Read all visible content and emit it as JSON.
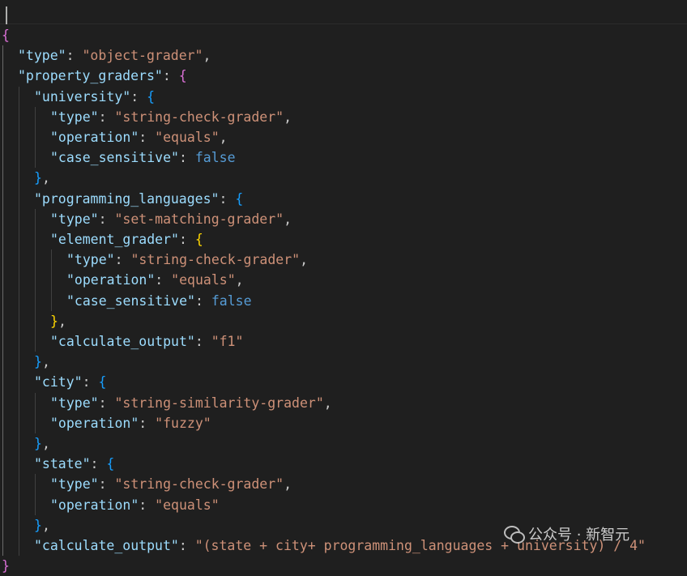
{
  "editor": {
    "language": "json",
    "colors": {
      "background": "#1f1f1f",
      "key": "#9cdcfe",
      "string": "#ce9178",
      "keyword": "#569cd6",
      "bracket_level1": "#da70d6",
      "bracket_level2": "#179fff",
      "bracket_level3": "#ffd700"
    },
    "lines": [
      {
        "indent": 0,
        "tokens": [
          {
            "t": "{",
            "c": "b1"
          }
        ]
      },
      {
        "indent": 1,
        "tokens": [
          {
            "t": "\"type\"",
            "c": "key"
          },
          {
            "t": ": ",
            "c": "punc"
          },
          {
            "t": "\"object-grader\"",
            "c": "str"
          },
          {
            "t": ",",
            "c": "punc"
          }
        ]
      },
      {
        "indent": 1,
        "tokens": [
          {
            "t": "\"property_graders\"",
            "c": "key"
          },
          {
            "t": ": ",
            "c": "punc"
          },
          {
            "t": "{",
            "c": "b1"
          }
        ]
      },
      {
        "indent": 2,
        "tokens": [
          {
            "t": "\"university\"",
            "c": "key"
          },
          {
            "t": ": ",
            "c": "punc"
          },
          {
            "t": "{",
            "c": "b2"
          }
        ]
      },
      {
        "indent": 3,
        "tokens": [
          {
            "t": "\"type\"",
            "c": "key"
          },
          {
            "t": ": ",
            "c": "punc"
          },
          {
            "t": "\"string-check-grader\"",
            "c": "str"
          },
          {
            "t": ",",
            "c": "punc"
          }
        ]
      },
      {
        "indent": 3,
        "tokens": [
          {
            "t": "\"operation\"",
            "c": "key"
          },
          {
            "t": ": ",
            "c": "punc"
          },
          {
            "t": "\"equals\"",
            "c": "str"
          },
          {
            "t": ",",
            "c": "punc"
          }
        ]
      },
      {
        "indent": 3,
        "tokens": [
          {
            "t": "\"case_sensitive\"",
            "c": "key"
          },
          {
            "t": ": ",
            "c": "punc"
          },
          {
            "t": "false",
            "c": "kw"
          }
        ]
      },
      {
        "indent": 2,
        "tokens": [
          {
            "t": "}",
            "c": "b2"
          },
          {
            "t": ",",
            "c": "punc"
          }
        ]
      },
      {
        "indent": 2,
        "tokens": [
          {
            "t": "\"programming_languages\"",
            "c": "key"
          },
          {
            "t": ": ",
            "c": "punc"
          },
          {
            "t": "{",
            "c": "b2"
          }
        ]
      },
      {
        "indent": 3,
        "tokens": [
          {
            "t": "\"type\"",
            "c": "key"
          },
          {
            "t": ": ",
            "c": "punc"
          },
          {
            "t": "\"set-matching-grader\"",
            "c": "str"
          },
          {
            "t": ",",
            "c": "punc"
          }
        ]
      },
      {
        "indent": 3,
        "tokens": [
          {
            "t": "\"element_grader\"",
            "c": "key"
          },
          {
            "t": ": ",
            "c": "punc"
          },
          {
            "t": "{",
            "c": "b3"
          }
        ]
      },
      {
        "indent": 4,
        "tokens": [
          {
            "t": "\"type\"",
            "c": "key"
          },
          {
            "t": ": ",
            "c": "punc"
          },
          {
            "t": "\"string-check-grader\"",
            "c": "str"
          },
          {
            "t": ",",
            "c": "punc"
          }
        ]
      },
      {
        "indent": 4,
        "tokens": [
          {
            "t": "\"operation\"",
            "c": "key"
          },
          {
            "t": ": ",
            "c": "punc"
          },
          {
            "t": "\"equals\"",
            "c": "str"
          },
          {
            "t": ",",
            "c": "punc"
          }
        ]
      },
      {
        "indent": 4,
        "tokens": [
          {
            "t": "\"case_sensitive\"",
            "c": "key"
          },
          {
            "t": ": ",
            "c": "punc"
          },
          {
            "t": "false",
            "c": "kw"
          }
        ]
      },
      {
        "indent": 3,
        "tokens": [
          {
            "t": "}",
            "c": "b3"
          },
          {
            "t": ",",
            "c": "punc"
          }
        ]
      },
      {
        "indent": 3,
        "tokens": [
          {
            "t": "\"calculate_output\"",
            "c": "key"
          },
          {
            "t": ": ",
            "c": "punc"
          },
          {
            "t": "\"f1\"",
            "c": "str"
          }
        ]
      },
      {
        "indent": 2,
        "tokens": [
          {
            "t": "}",
            "c": "b2"
          },
          {
            "t": ",",
            "c": "punc"
          }
        ]
      },
      {
        "indent": 2,
        "tokens": [
          {
            "t": "\"city\"",
            "c": "key"
          },
          {
            "t": ": ",
            "c": "punc"
          },
          {
            "t": "{",
            "c": "b2"
          }
        ]
      },
      {
        "indent": 3,
        "tokens": [
          {
            "t": "\"type\"",
            "c": "key"
          },
          {
            "t": ": ",
            "c": "punc"
          },
          {
            "t": "\"string-similarity-grader\"",
            "c": "str"
          },
          {
            "t": ",",
            "c": "punc"
          }
        ]
      },
      {
        "indent": 3,
        "tokens": [
          {
            "t": "\"operation\"",
            "c": "key"
          },
          {
            "t": ": ",
            "c": "punc"
          },
          {
            "t": "\"fuzzy\"",
            "c": "str"
          }
        ]
      },
      {
        "indent": 2,
        "tokens": [
          {
            "t": "}",
            "c": "b2"
          },
          {
            "t": ",",
            "c": "punc"
          }
        ]
      },
      {
        "indent": 2,
        "tokens": [
          {
            "t": "\"state\"",
            "c": "key"
          },
          {
            "t": ": ",
            "c": "punc"
          },
          {
            "t": "{",
            "c": "b2"
          }
        ]
      },
      {
        "indent": 3,
        "tokens": [
          {
            "t": "\"type\"",
            "c": "key"
          },
          {
            "t": ": ",
            "c": "punc"
          },
          {
            "t": "\"string-check-grader\"",
            "c": "str"
          },
          {
            "t": ",",
            "c": "punc"
          }
        ]
      },
      {
        "indent": 3,
        "tokens": [
          {
            "t": "\"operation\"",
            "c": "key"
          },
          {
            "t": ": ",
            "c": "punc"
          },
          {
            "t": "\"equals\"",
            "c": "str"
          }
        ]
      },
      {
        "indent": 2,
        "tokens": [
          {
            "t": "}",
            "c": "b2"
          },
          {
            "t": ",",
            "c": "punc"
          }
        ]
      },
      {
        "indent": 2,
        "tokens": [
          {
            "t": "\"calculate_output\"",
            "c": "key"
          },
          {
            "t": ": ",
            "c": "punc"
          },
          {
            "t": "\"(state + city+ programming_languages + university) / 4\"",
            "c": "str"
          }
        ]
      },
      {
        "indent": 0,
        "tokens": [
          {
            "t": "}",
            "c": "b1"
          }
        ]
      }
    ]
  },
  "watermark": {
    "text": "公众号 · 新智元",
    "icon": "wechat-icon"
  }
}
